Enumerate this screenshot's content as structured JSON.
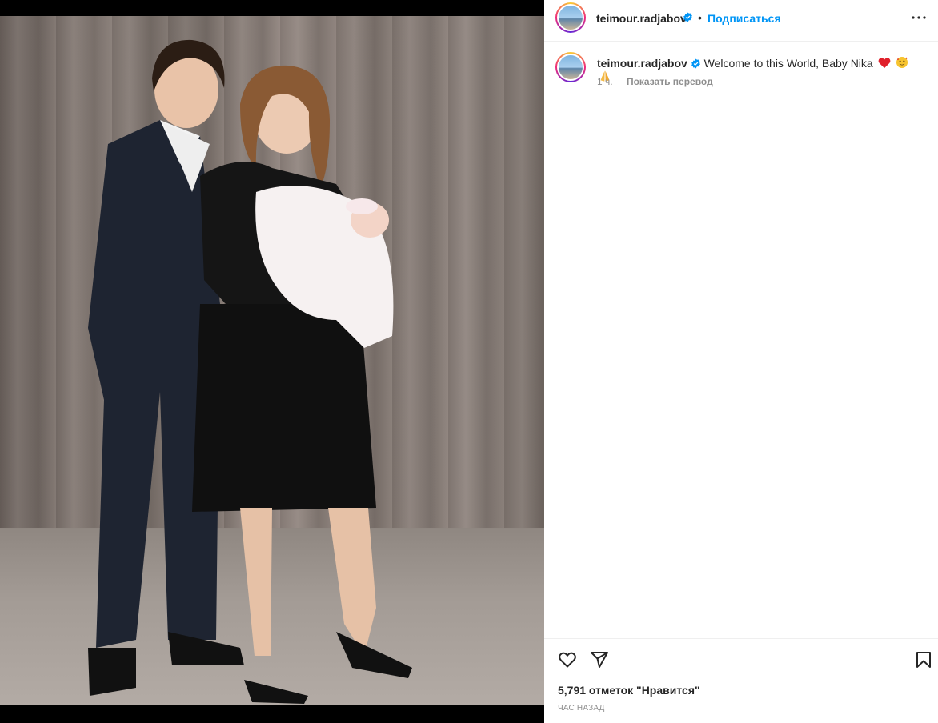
{
  "post": {
    "username": "teimour.radjabov",
    "separator": "•",
    "follow_label": "Подписаться",
    "caption_text": "Welcome to this World, Baby Nika",
    "caption_emojis": [
      "red-heart",
      "smiling-face-with-hearts",
      "folded-hands"
    ],
    "time_short": "1 ч.",
    "translate_label": "Показать перевод",
    "likes_label": "5,791 отметок \"Нравится\"",
    "time_ago": "ЧАС НАЗАД"
  },
  "colors": {
    "accent": "#0095f6",
    "text": "#262626",
    "muted": "#8e8e8e",
    "verified": "#0095f6"
  },
  "icons": {
    "more": "more-horizontal-icon",
    "like": "heart-outline-icon",
    "share": "paper-plane-icon",
    "save": "bookmark-icon",
    "verified": "verified-badge-icon"
  }
}
